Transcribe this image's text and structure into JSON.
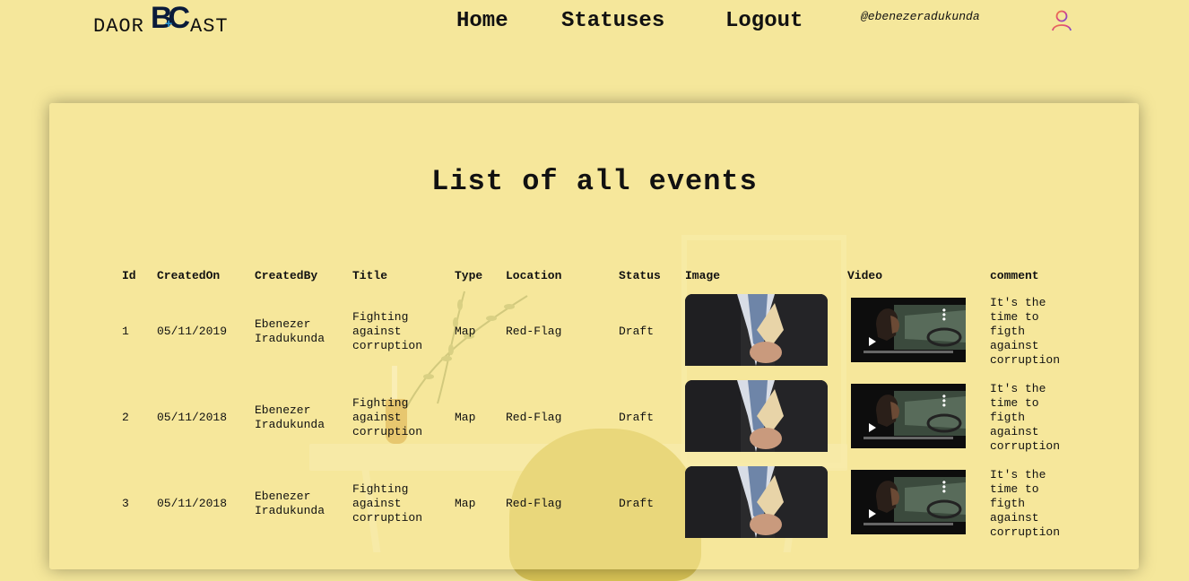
{
  "header": {
    "logo_left": "DAOR",
    "logo_mark": "BC",
    "logo_right": "AST",
    "nav": [
      "Home",
      "Statuses",
      "Logout"
    ],
    "username": "@ebenezeradukunda",
    "user_icon": "user-icon"
  },
  "page": {
    "title": "List of all events"
  },
  "table": {
    "columns": [
      "Id",
      "CreatedOn",
      "CreatedBy",
      "Title",
      "Type",
      "Location",
      "Status",
      "Image",
      "Video",
      "comment"
    ],
    "rows": [
      {
        "id": "1",
        "created_on": "05/11/2019",
        "created_by": [
          "Ebenezer",
          "Iradukunda"
        ],
        "title": [
          "Fighting",
          "against",
          "corruption"
        ],
        "type": "Map",
        "location": "Red-Flag",
        "status": "Draft",
        "comment": [
          "It's the",
          "time to",
          "figth",
          "against",
          "corruption"
        ]
      },
      {
        "id": "2",
        "created_on": "05/11/2018",
        "created_by": [
          "Ebenezer",
          "Iradukunda"
        ],
        "title": [
          "Fighting",
          "against",
          "corruption"
        ],
        "type": "Map",
        "location": "Red-Flag",
        "status": "Draft",
        "comment": [
          "It's the",
          "time to",
          "figth",
          "against",
          "corruption"
        ]
      },
      {
        "id": "3",
        "created_on": "05/11/2018",
        "created_by": [
          "Ebenezer",
          "Iradukunda"
        ],
        "title": [
          "Fighting",
          "against",
          "corruption"
        ],
        "type": "Map",
        "location": "Red-Flag",
        "status": "Draft",
        "comment": [
          "It's the",
          "time to",
          "figth",
          "against",
          "corruption"
        ]
      }
    ]
  },
  "colors": {
    "background": "#f5e79b",
    "logo_accent": "#2b9bd7"
  }
}
